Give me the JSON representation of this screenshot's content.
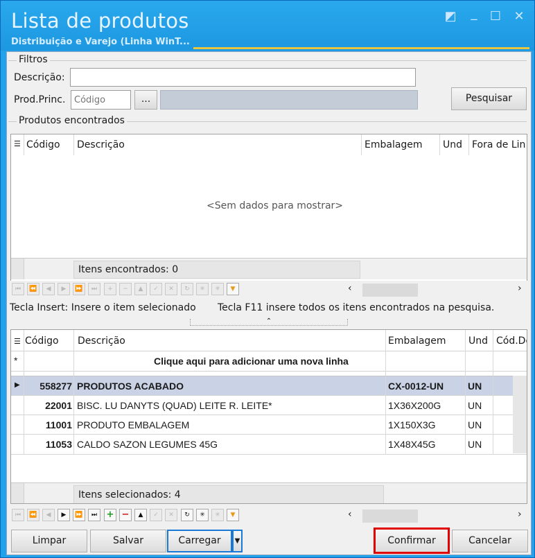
{
  "window": {
    "title": "Lista de produtos",
    "subtitle": "Distribuição e Varejo (Linha WinT...",
    "buttons": {
      "restore": "◩",
      "minimize": "_",
      "maximize": "☐",
      "close": "✕"
    }
  },
  "filters": {
    "group_label": "Filtros",
    "description_label": "Descrição:",
    "description_value": "",
    "prodprinc_label": "Prod.Princ.",
    "code_placeholder": "Código",
    "browse_label": "...",
    "search_button": "Pesquisar"
  },
  "found": {
    "group_label": "Produtos encontrados",
    "columns": [
      "Código",
      "Descrição",
      "Embalagem",
      "Und",
      "Fora de Lin"
    ],
    "empty_text": "<Sem dados para mostrar>",
    "footer_label": "Itens encontrados: 0"
  },
  "hints": {
    "insert": "Tecla Insert: Insere o item selecionado",
    "f11": "Tecla F11 insere todos os itens encontrados na pesquisa."
  },
  "selected": {
    "columns": [
      "Código",
      "Descrição",
      "Embalagem",
      "Und",
      "Cód.De"
    ],
    "new_row_text": "Clique aqui para adicionar uma nova linha",
    "new_row_marker": "*",
    "rows": [
      {
        "codigo": "558277",
        "descricao": "PRODUTOS ACABADO",
        "embalagem": "CX-0012-UN",
        "und": "UN"
      },
      {
        "codigo": "22001",
        "descricao": "BISC. LU DANYTS (QUAD) LEITE R. LEITE*",
        "embalagem": "1X36X200G",
        "und": "UN"
      },
      {
        "codigo": "11001",
        "descricao": "PRODUTO EMBALAGEM",
        "embalagem": "1X150X3G",
        "und": "UN"
      },
      {
        "codigo": "11053",
        "descricao": "CALDO SAZON LEGUMES 45G",
        "embalagem": "1X48X45G",
        "und": "UN"
      }
    ],
    "footer_label": "Itens selecionados: 4"
  },
  "actions": {
    "clear": "Limpar",
    "save": "Salvar",
    "load": "Carregar",
    "confirm": "Confirmar",
    "cancel": "Cancelar"
  },
  "colors": {
    "titlebar": "#22a2ea",
    "highlight": "#e00000",
    "selected_row": "#cad3e6"
  }
}
